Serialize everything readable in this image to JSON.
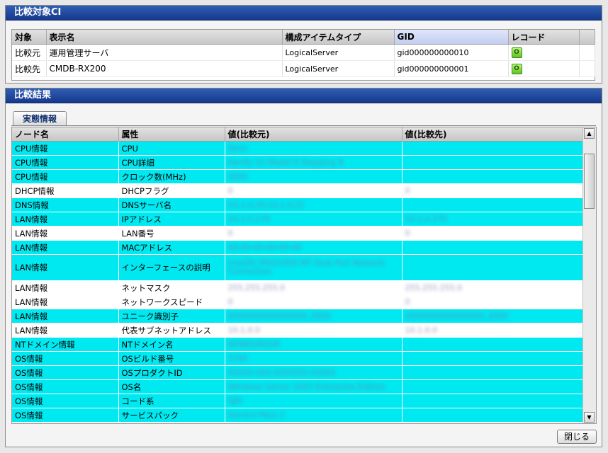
{
  "compare_target": {
    "title": "比較対象CI",
    "columns": [
      "対象",
      "表示名",
      "構成アイテムタイプ",
      "GID",
      "レコード"
    ],
    "rows": [
      {
        "target": "比較元",
        "display_name": "運用管理サーバ",
        "type": "LogicalServer",
        "gid": "gid000000000010",
        "record": "O"
      },
      {
        "target": "比較先",
        "display_name": "CMDB-RX200",
        "type": "LogicalServer",
        "gid": "gid000000000001",
        "record": "O"
      }
    ]
  },
  "compare_result": {
    "title": "比較結果",
    "tab": "実態情報",
    "columns": [
      "ノード名",
      "属性",
      "値(比較元)",
      "値(比較先)"
    ],
    "rows": [
      {
        "node": "CPU情報",
        "attr": "CPU",
        "src": "Xeon",
        "dst": "",
        "diff": true
      },
      {
        "node": "CPU情報",
        "attr": "CPU詳細",
        "src": "Family 15 Model 6 Stepping 8",
        "dst": "",
        "diff": true
      },
      {
        "node": "CPU情報",
        "attr": "クロック数(MHz)",
        "src": "3000",
        "dst": "",
        "diff": true
      },
      {
        "node": "DHCP情報",
        "attr": "DHCPフラグ",
        "src": "0",
        "dst": "0",
        "diff": false
      },
      {
        "node": "DNS情報",
        "attr": "DNSサーバ名",
        "src": "10.1.0.20,10.1.0.21",
        "dst": "",
        "diff": true
      },
      {
        "node": "LAN情報",
        "attr": "IPアドレス",
        "src": "10.1.0.170",
        "dst": "10.1.0.170",
        "diff": true
      },
      {
        "node": "LAN情報",
        "attr": "LAN番号",
        "src": "0",
        "dst": "0",
        "diff": false
      },
      {
        "node": "LAN情報",
        "attr": "MACアドレス",
        "src": "00-00-00-00-00-00",
        "dst": "",
        "diff": true
      },
      {
        "node": "LAN情報",
        "attr": "インターフェースの説明",
        "src": "Intel(R) PRO/1000 MT Dual Port Network Connection",
        "dst": "",
        "diff": true,
        "tall": true
      },
      {
        "node": "LAN情報",
        "attr": "ネットマスク",
        "src": "255.255.255.0",
        "dst": "255.255.255.0",
        "diff": false
      },
      {
        "node": "LAN情報",
        "attr": "ネットワークスピード",
        "src": "0",
        "dst": "0",
        "diff": false
      },
      {
        "node": "LAN情報",
        "attr": "ユニーク識別子",
        "src": "0000000000000000_0000",
        "dst": "0000000000000000_0000",
        "diff": true
      },
      {
        "node": "LAN情報",
        "attr": "代表サブネットアドレス",
        "src": "10.1.0.0",
        "dst": "10.1.0.0",
        "diff": false
      },
      {
        "node": "NTドメイン情報",
        "attr": "NTドメイン名",
        "src": "WORKGROUP",
        "dst": "",
        "diff": true
      },
      {
        "node": "OS情報",
        "attr": "OSビルド番号",
        "src": "3790",
        "dst": "",
        "diff": true
      },
      {
        "node": "OS情報",
        "attr": "OSプロダクトID",
        "src": "00000-000-0000000-00000",
        "dst": "",
        "diff": true
      },
      {
        "node": "OS情報",
        "attr": "OS名",
        "src": "Windows Server 2003 Enterprise Edition",
        "dst": "",
        "diff": true
      },
      {
        "node": "OS情報",
        "attr": "コード系",
        "src": "SJIS",
        "dst": "",
        "diff": true
      },
      {
        "node": "OS情報",
        "attr": "サービスパック",
        "src": "Service Pack 2",
        "dst": "",
        "diff": true
      }
    ]
  },
  "close_label": "閉じる",
  "colors": {
    "diff_row": "#00e8f0",
    "header_blue": "#1e4aa0"
  }
}
